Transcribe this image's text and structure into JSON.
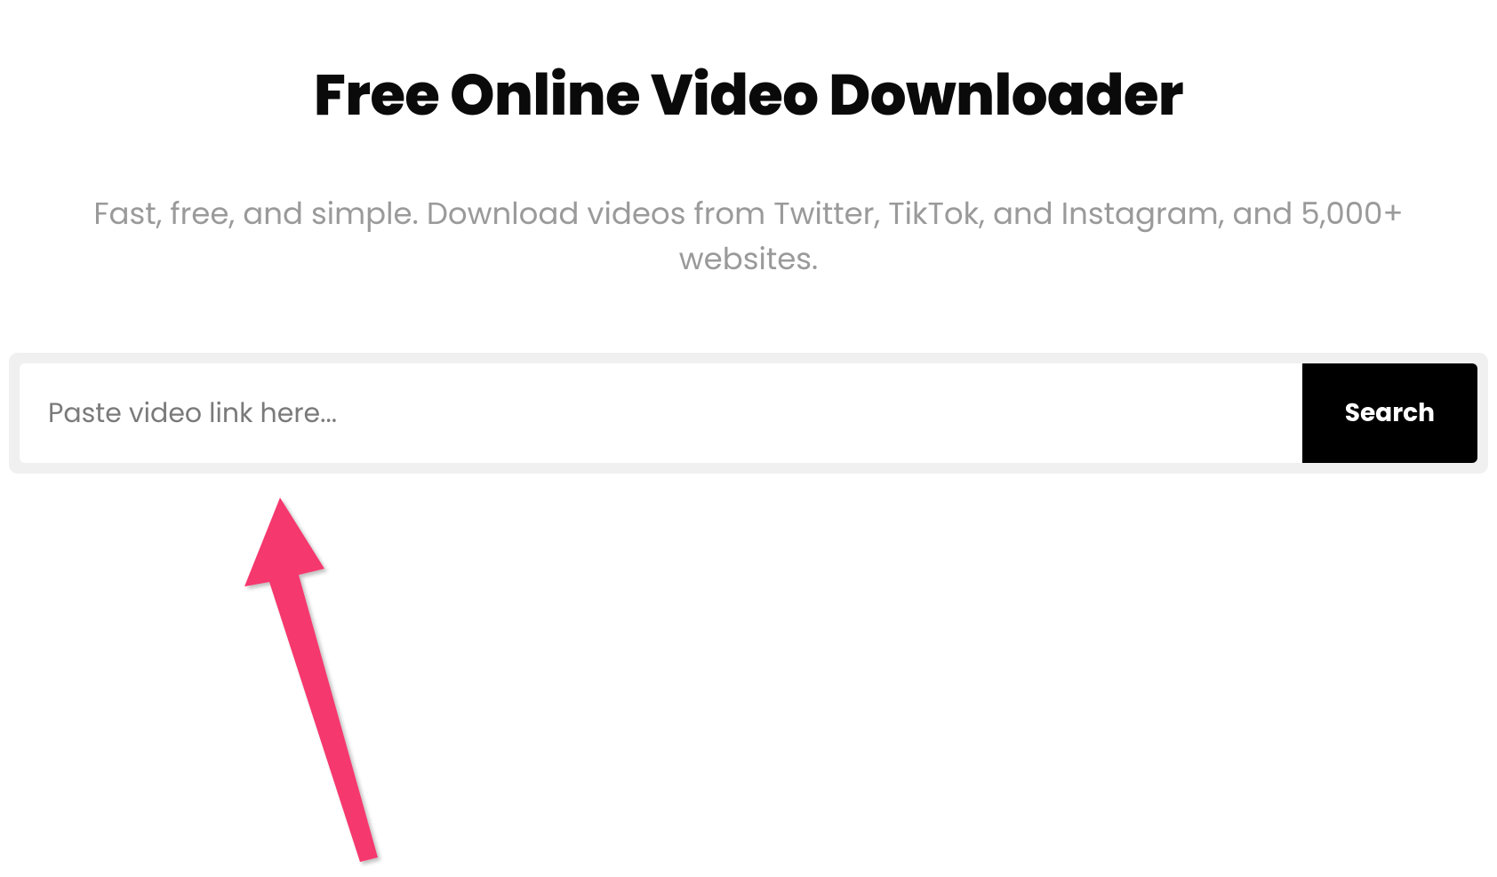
{
  "header": {
    "title": "Free Online Video Downloader",
    "subtitle": "Fast, free, and simple. Download videos from Twitter, TikTok, and Instagram, and 5,000+ websites."
  },
  "search": {
    "placeholder": "Paste video link here...",
    "value": "",
    "button_label": "Search"
  },
  "annotation": {
    "arrow_color": "#f5376e"
  }
}
